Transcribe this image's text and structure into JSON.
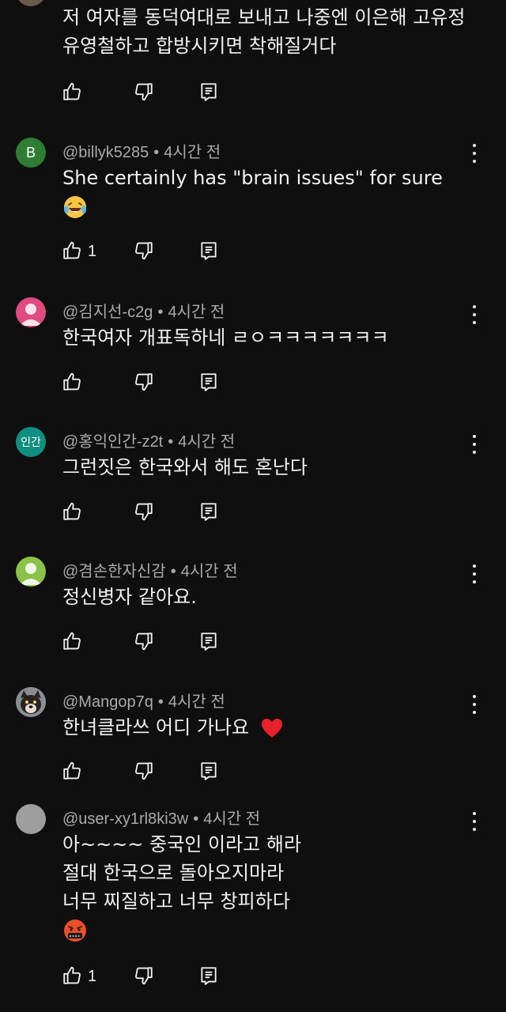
{
  "comments": [
    {
      "author": "",
      "time": "",
      "lines": [
        "저 여자를 동덕여대로 보내고 나중엔 이은해 고유정",
        "유영철하고 합방시키면 착해질거다"
      ],
      "likes": ""
    },
    {
      "author": "@billyk5285",
      "time": "4시간 전",
      "avatar_letter": "B",
      "avatar_color": "#2e7d32",
      "lines": [
        "She certainly has \"brain issues\" for sure"
      ],
      "emoji": "laughing-tears",
      "likes": "1"
    },
    {
      "author": "@김지선-c2g",
      "time": "4시간 전",
      "avatar_color": "#e04a7f",
      "lines": [
        "한국여자 개표독하네 ㄹㅇㅋㅋㅋㅋㅋㅋㅋ"
      ],
      "likes": ""
    },
    {
      "author": "@홍익인간-z2t",
      "time": "4시간 전",
      "avatar_letter": "인간",
      "avatar_color": "#0f8f7f",
      "lines": [
        "그런짓은 한국와서 해도 혼난다"
      ],
      "likes": ""
    },
    {
      "author": "@겸손한자신감",
      "time": "4시간 전",
      "avatar_color": "#8bc34a",
      "lines": [
        "정신병자 같아요."
      ],
      "likes": ""
    },
    {
      "author": "@Mangop7q",
      "time": "4시간 전",
      "avatar_color": "#5a4a3a",
      "lines": [
        "한녀클라쓰 어디 가나요"
      ],
      "emoji": "red-heart",
      "likes": ""
    },
    {
      "author": "@user-xy1rl8ki3w",
      "time": "4시간 전",
      "avatar_color": "#9e9e9e",
      "lines": [
        "아~~~~ 중국인 이라고 해라",
        "절대 한국으로 돌아오지마라",
        "너무 찌질하고 너무 창피하다"
      ],
      "emoji": "swearing-face",
      "likes": "1"
    }
  ],
  "colors": {
    "background": "#0f0f0f",
    "text": "#f1f1f1",
    "meta": "#aaaaaa"
  },
  "icons": {
    "like": "thumbs-up-icon",
    "dislike": "thumbs-down-icon",
    "reply": "reply-icon",
    "menu": "more-vert-icon"
  }
}
